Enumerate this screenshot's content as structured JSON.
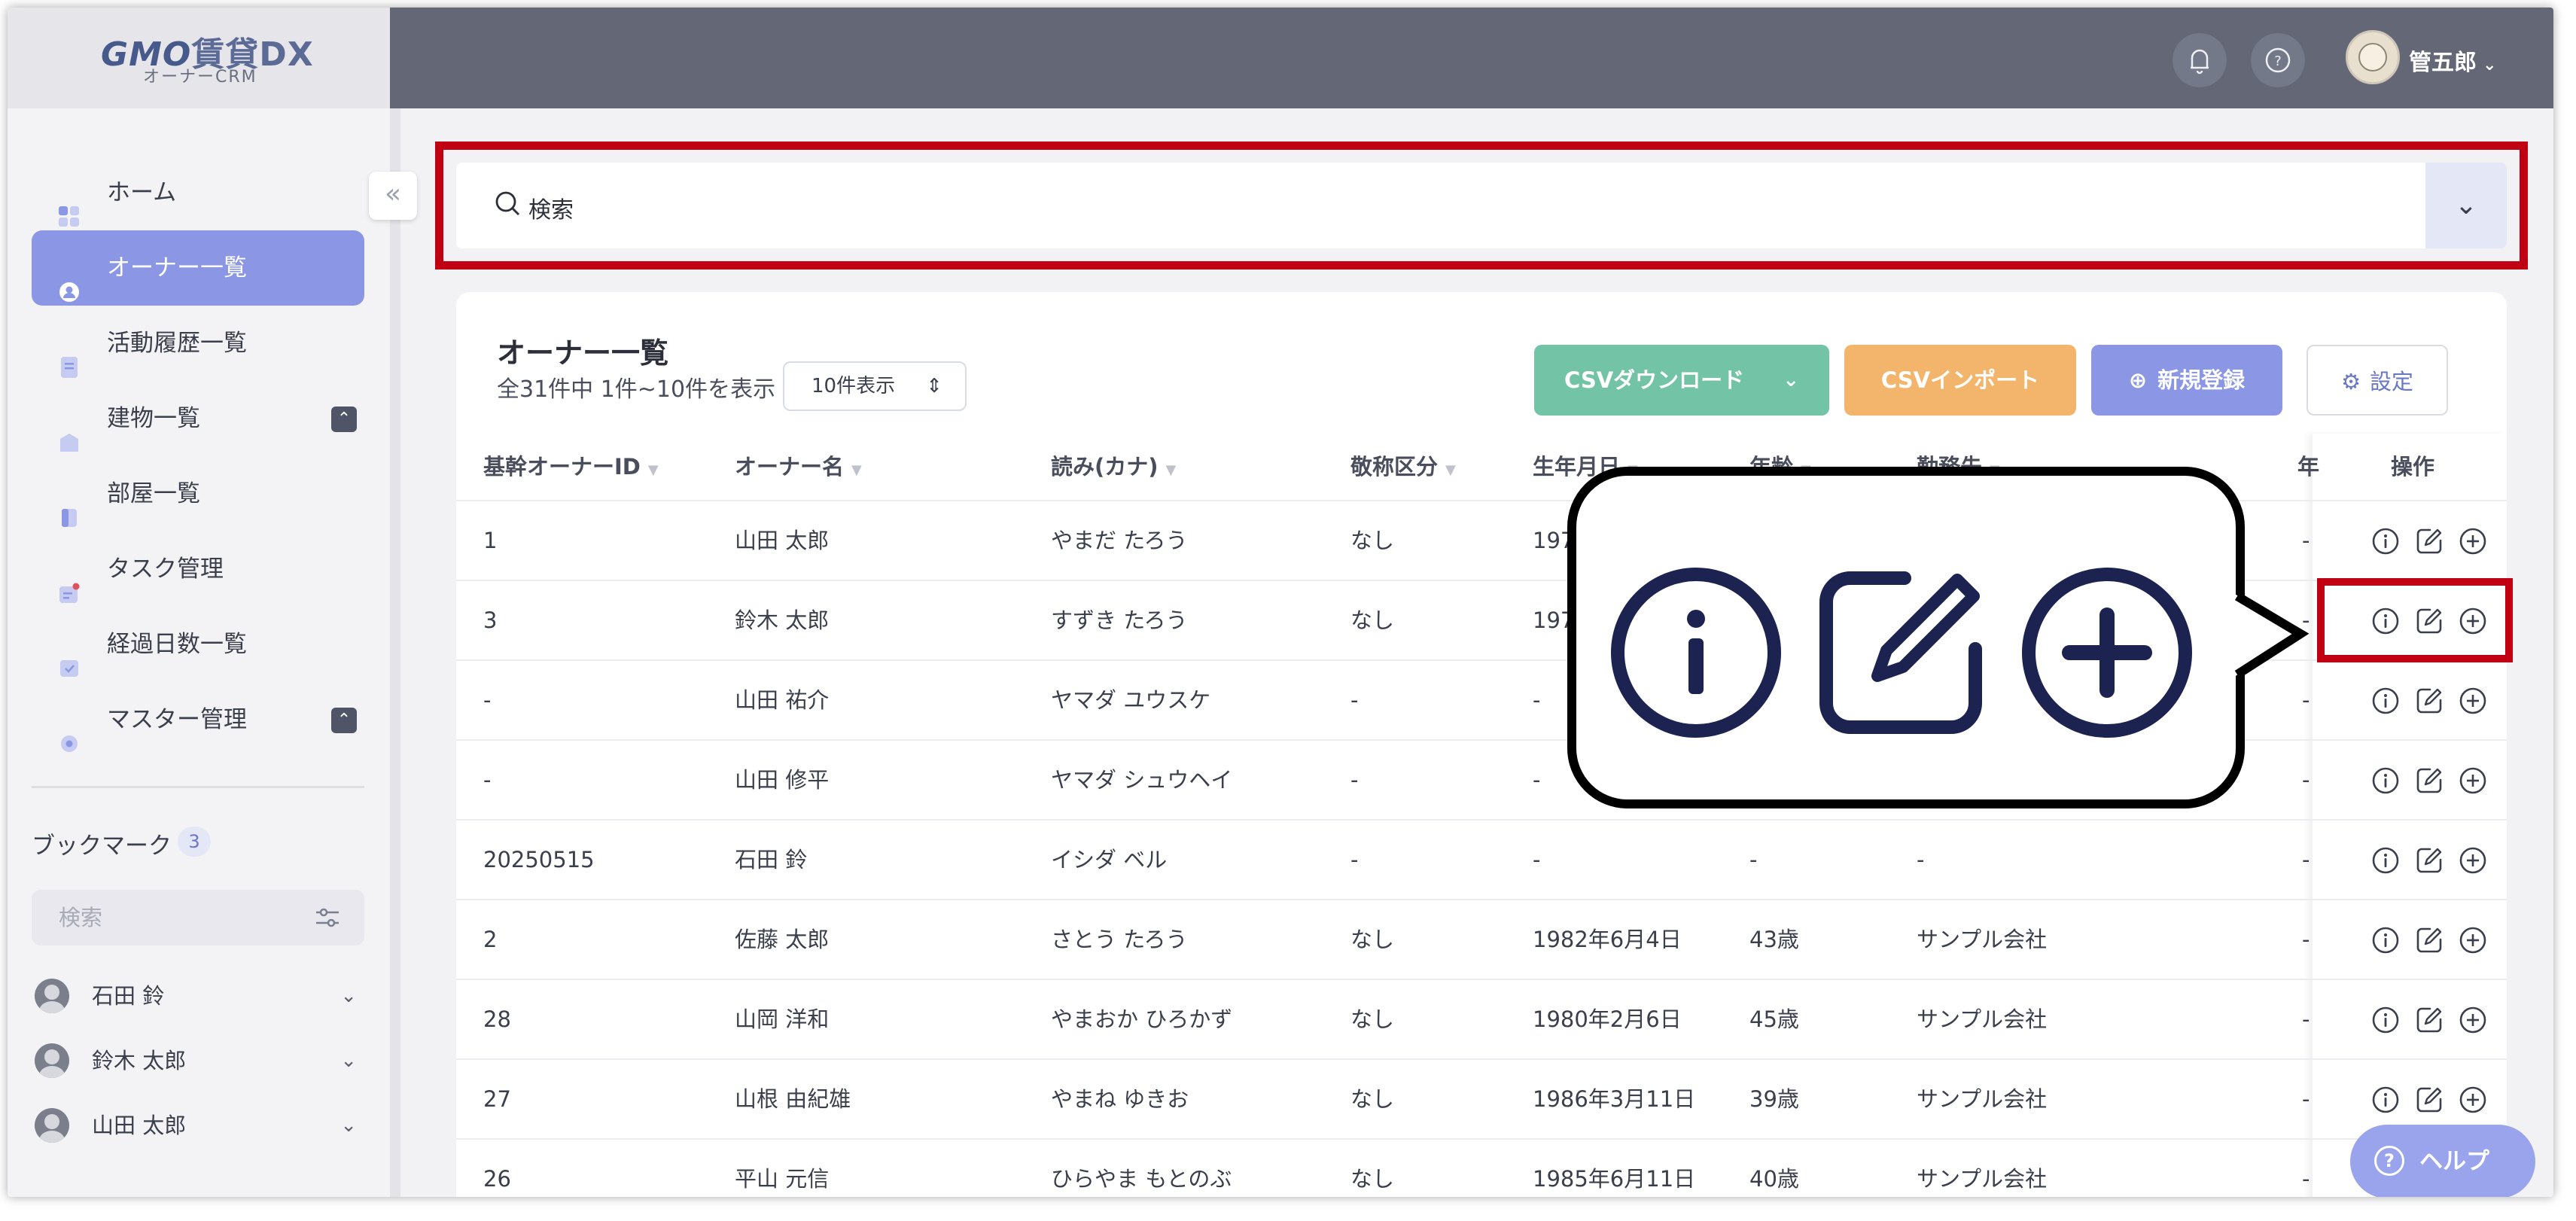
{
  "app": {
    "logo_brand": "GMO",
    "logo_product": "賃貸DX",
    "logo_sub": "オーナーCRM"
  },
  "header": {
    "username": "管五郎",
    "bell_icon": "bell-icon",
    "help_icon": "question-circle-icon"
  },
  "sidebar": {
    "items": [
      {
        "label": "ホーム",
        "icon": "grid-icon"
      },
      {
        "label": "オーナー一覧",
        "icon": "user-circle-icon",
        "active": true
      },
      {
        "label": "活動履歴一覧",
        "icon": "document-icon"
      },
      {
        "label": "建物一覧",
        "icon": "building-icon",
        "expandable": true
      },
      {
        "label": "部屋一覧",
        "icon": "door-icon"
      },
      {
        "label": "タスク管理",
        "icon": "task-icon"
      },
      {
        "label": "経過日数一覧",
        "icon": "calendar-check-icon"
      },
      {
        "label": "マスター管理",
        "icon": "gear-icon",
        "expandable": true
      }
    ],
    "bookmark_title": "ブックマーク",
    "bookmark_count": "3",
    "bookmark_search_placeholder": "検索",
    "bookmarks": [
      {
        "name": "石田 鈴"
      },
      {
        "name": "鈴木 太郎"
      },
      {
        "name": "山田 太郎"
      }
    ]
  },
  "search": {
    "placeholder": "検索"
  },
  "list": {
    "title": "オーナー一覧",
    "summary": "全31件中 1件~10件を表示",
    "per_page": "10件表示",
    "buttons": {
      "csv_download": "CSVダウンロード",
      "csv_import": "CSVインポート",
      "new": "新規登録",
      "settings": "設定"
    },
    "columns": [
      "基幹オーナーID",
      "オーナー名",
      "読み(カナ)",
      "敬称区分",
      "生年月日",
      "年齢",
      "勤務先",
      "年",
      "操作"
    ],
    "rows": [
      {
        "id": "1",
        "name": "山田 太郎",
        "kana": "やまだ たろう",
        "honorific": "なし",
        "birth": "197",
        "age": "",
        "company": "",
        "extra": "-"
      },
      {
        "id": "3",
        "name": "鈴木 太郎",
        "kana": "すずき たろう",
        "honorific": "なし",
        "birth": "197",
        "age": "",
        "company": "",
        "extra": "-"
      },
      {
        "id": "-",
        "name": "山田 祐介",
        "kana": "ヤマダ ユウスケ",
        "honorific": "-",
        "birth": "-",
        "age": "",
        "company": "",
        "extra": "-"
      },
      {
        "id": "-",
        "name": "山田 修平",
        "kana": "ヤマダ シュウヘイ",
        "honorific": "-",
        "birth": "-",
        "age": "",
        "company": "",
        "extra": "-"
      },
      {
        "id": "20250515",
        "name": "石田 鈴",
        "kana": "イシダ ベル",
        "honorific": "-",
        "birth": "-",
        "age": "-",
        "company": "-",
        "extra": "-"
      },
      {
        "id": "2",
        "name": "佐藤 太郎",
        "kana": "さとう たろう",
        "honorific": "なし",
        "birth": "1982年6月4日",
        "age": "43歳",
        "company": "サンプル会社",
        "extra": "-"
      },
      {
        "id": "28",
        "name": "山岡 洋和",
        "kana": "やまおか ひろかず",
        "honorific": "なし",
        "birth": "1980年2月6日",
        "age": "45歳",
        "company": "サンプル会社",
        "extra": "-"
      },
      {
        "id": "27",
        "name": "山根 由紀雄",
        "kana": "やまね ゆきお",
        "honorific": "なし",
        "birth": "1986年3月11日",
        "age": "39歳",
        "company": "サンプル会社",
        "extra": "-"
      },
      {
        "id": "26",
        "name": "平山 元信",
        "kana": "ひらやま もとのぶ",
        "honorific": "なし",
        "birth": "1985年6月11日",
        "age": "40歳",
        "company": "サンプル会社",
        "extra": "-"
      }
    ]
  },
  "help": {
    "label": "ヘルプ"
  },
  "colors": {
    "accent": "#8b97e4",
    "highlight": "#c00012",
    "csv_download": "#73c4a6",
    "csv_import": "#f2b56b",
    "icon_dark": "#1c2350"
  }
}
